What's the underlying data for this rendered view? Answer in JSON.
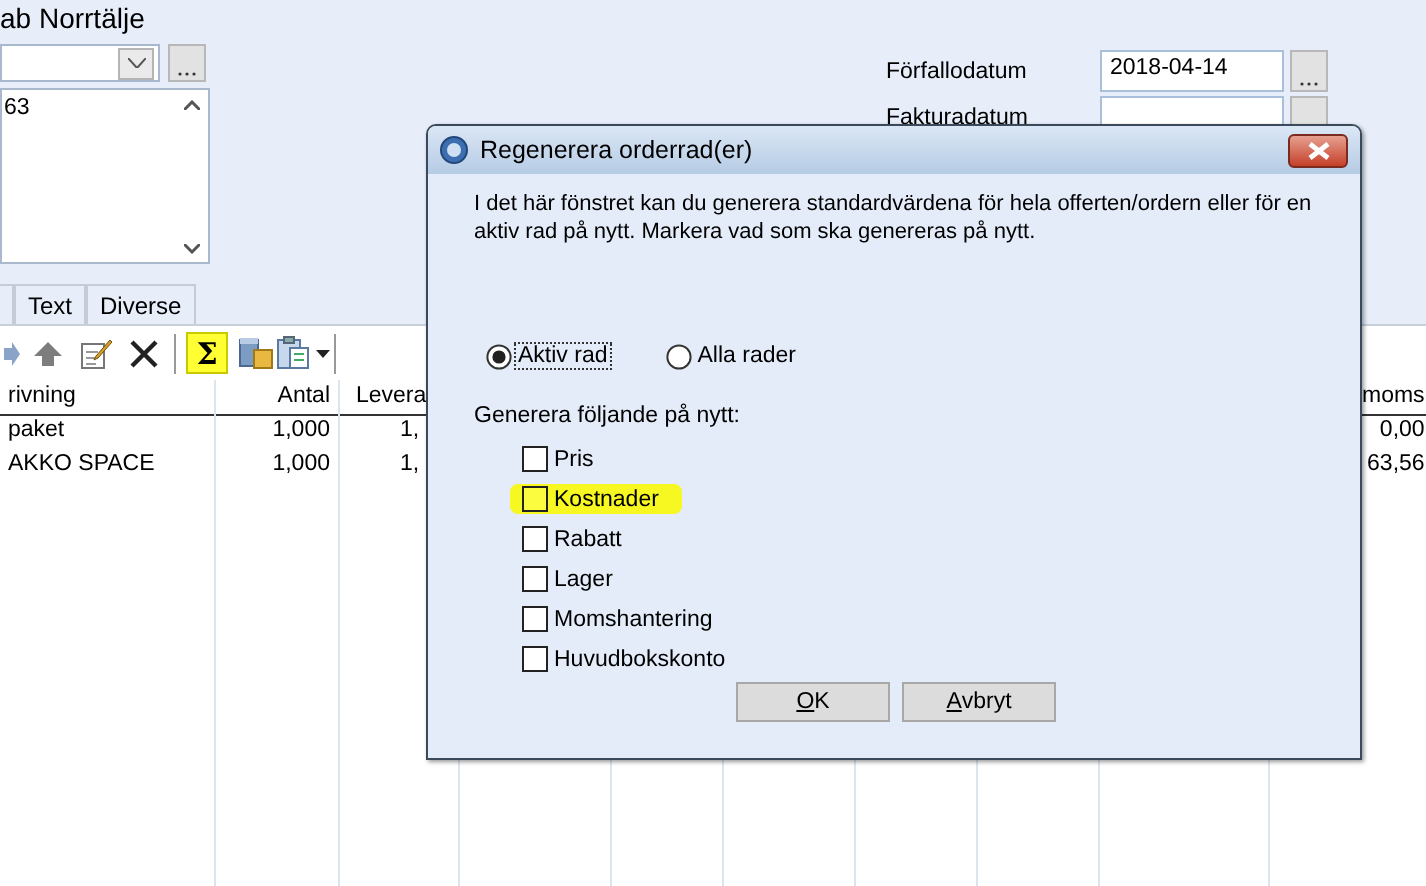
{
  "header": {
    "company": "ab Norrtälje",
    "address_line": "63"
  },
  "dates": [
    {
      "label": "Förfallodatum",
      "value": "2018-04-14"
    },
    {
      "label": "Fakturadatum"
    }
  ],
  "tabs": [
    {
      "label": "Text",
      "selected": false
    },
    {
      "label": "Diverse",
      "selected": false
    }
  ],
  "toolbar": [
    {
      "kind": "next",
      "highlighted": false
    },
    {
      "kind": "up",
      "highlighted": false
    },
    {
      "kind": "edit",
      "highlighted": false
    },
    {
      "kind": "delete",
      "highlighted": false
    },
    {
      "kind": "sum",
      "label": "Σ",
      "highlighted": true
    },
    {
      "kind": "stock",
      "highlighted": false
    },
    {
      "kind": "paste",
      "highlighted": false
    }
  ],
  "table": {
    "columns": [
      "rivning",
      "Antal",
      "Levera",
      "moms"
    ],
    "rows": [
      {
        "cells": [
          "paket",
          "1,000",
          "1,",
          "0,00"
        ]
      },
      {
        "cells": [
          "AKKO SPACE",
          "1,000",
          "1,",
          "63,56"
        ]
      }
    ]
  },
  "dialog": {
    "title": "Regenerera orderrad(er)",
    "intro": "I det här fönstret kan du generera standardvärdena för hela offerten/ordern eller för en aktiv rad på nytt. Markera vad som ska genereras på nytt.",
    "scope": [
      {
        "label": "Aktiv rad",
        "selected": true
      },
      {
        "label": "Alla rader",
        "selected": false
      }
    ],
    "group_label": "Generera följande på nytt:",
    "options": [
      {
        "label": "Pris",
        "checked": false,
        "highlighted": false
      },
      {
        "label": "Kostnader",
        "checked": false,
        "highlighted": true
      },
      {
        "label": "Rabatt",
        "checked": false,
        "highlighted": false
      },
      {
        "label": "Lager",
        "checked": false,
        "highlighted": false
      },
      {
        "label": "Momshantering",
        "checked": false,
        "highlighted": false
      },
      {
        "label": "Huvudbokskonto",
        "checked": false,
        "highlighted": false
      }
    ],
    "buttons": [
      {
        "label": "OK"
      },
      {
        "label": "Avbryt"
      }
    ]
  }
}
